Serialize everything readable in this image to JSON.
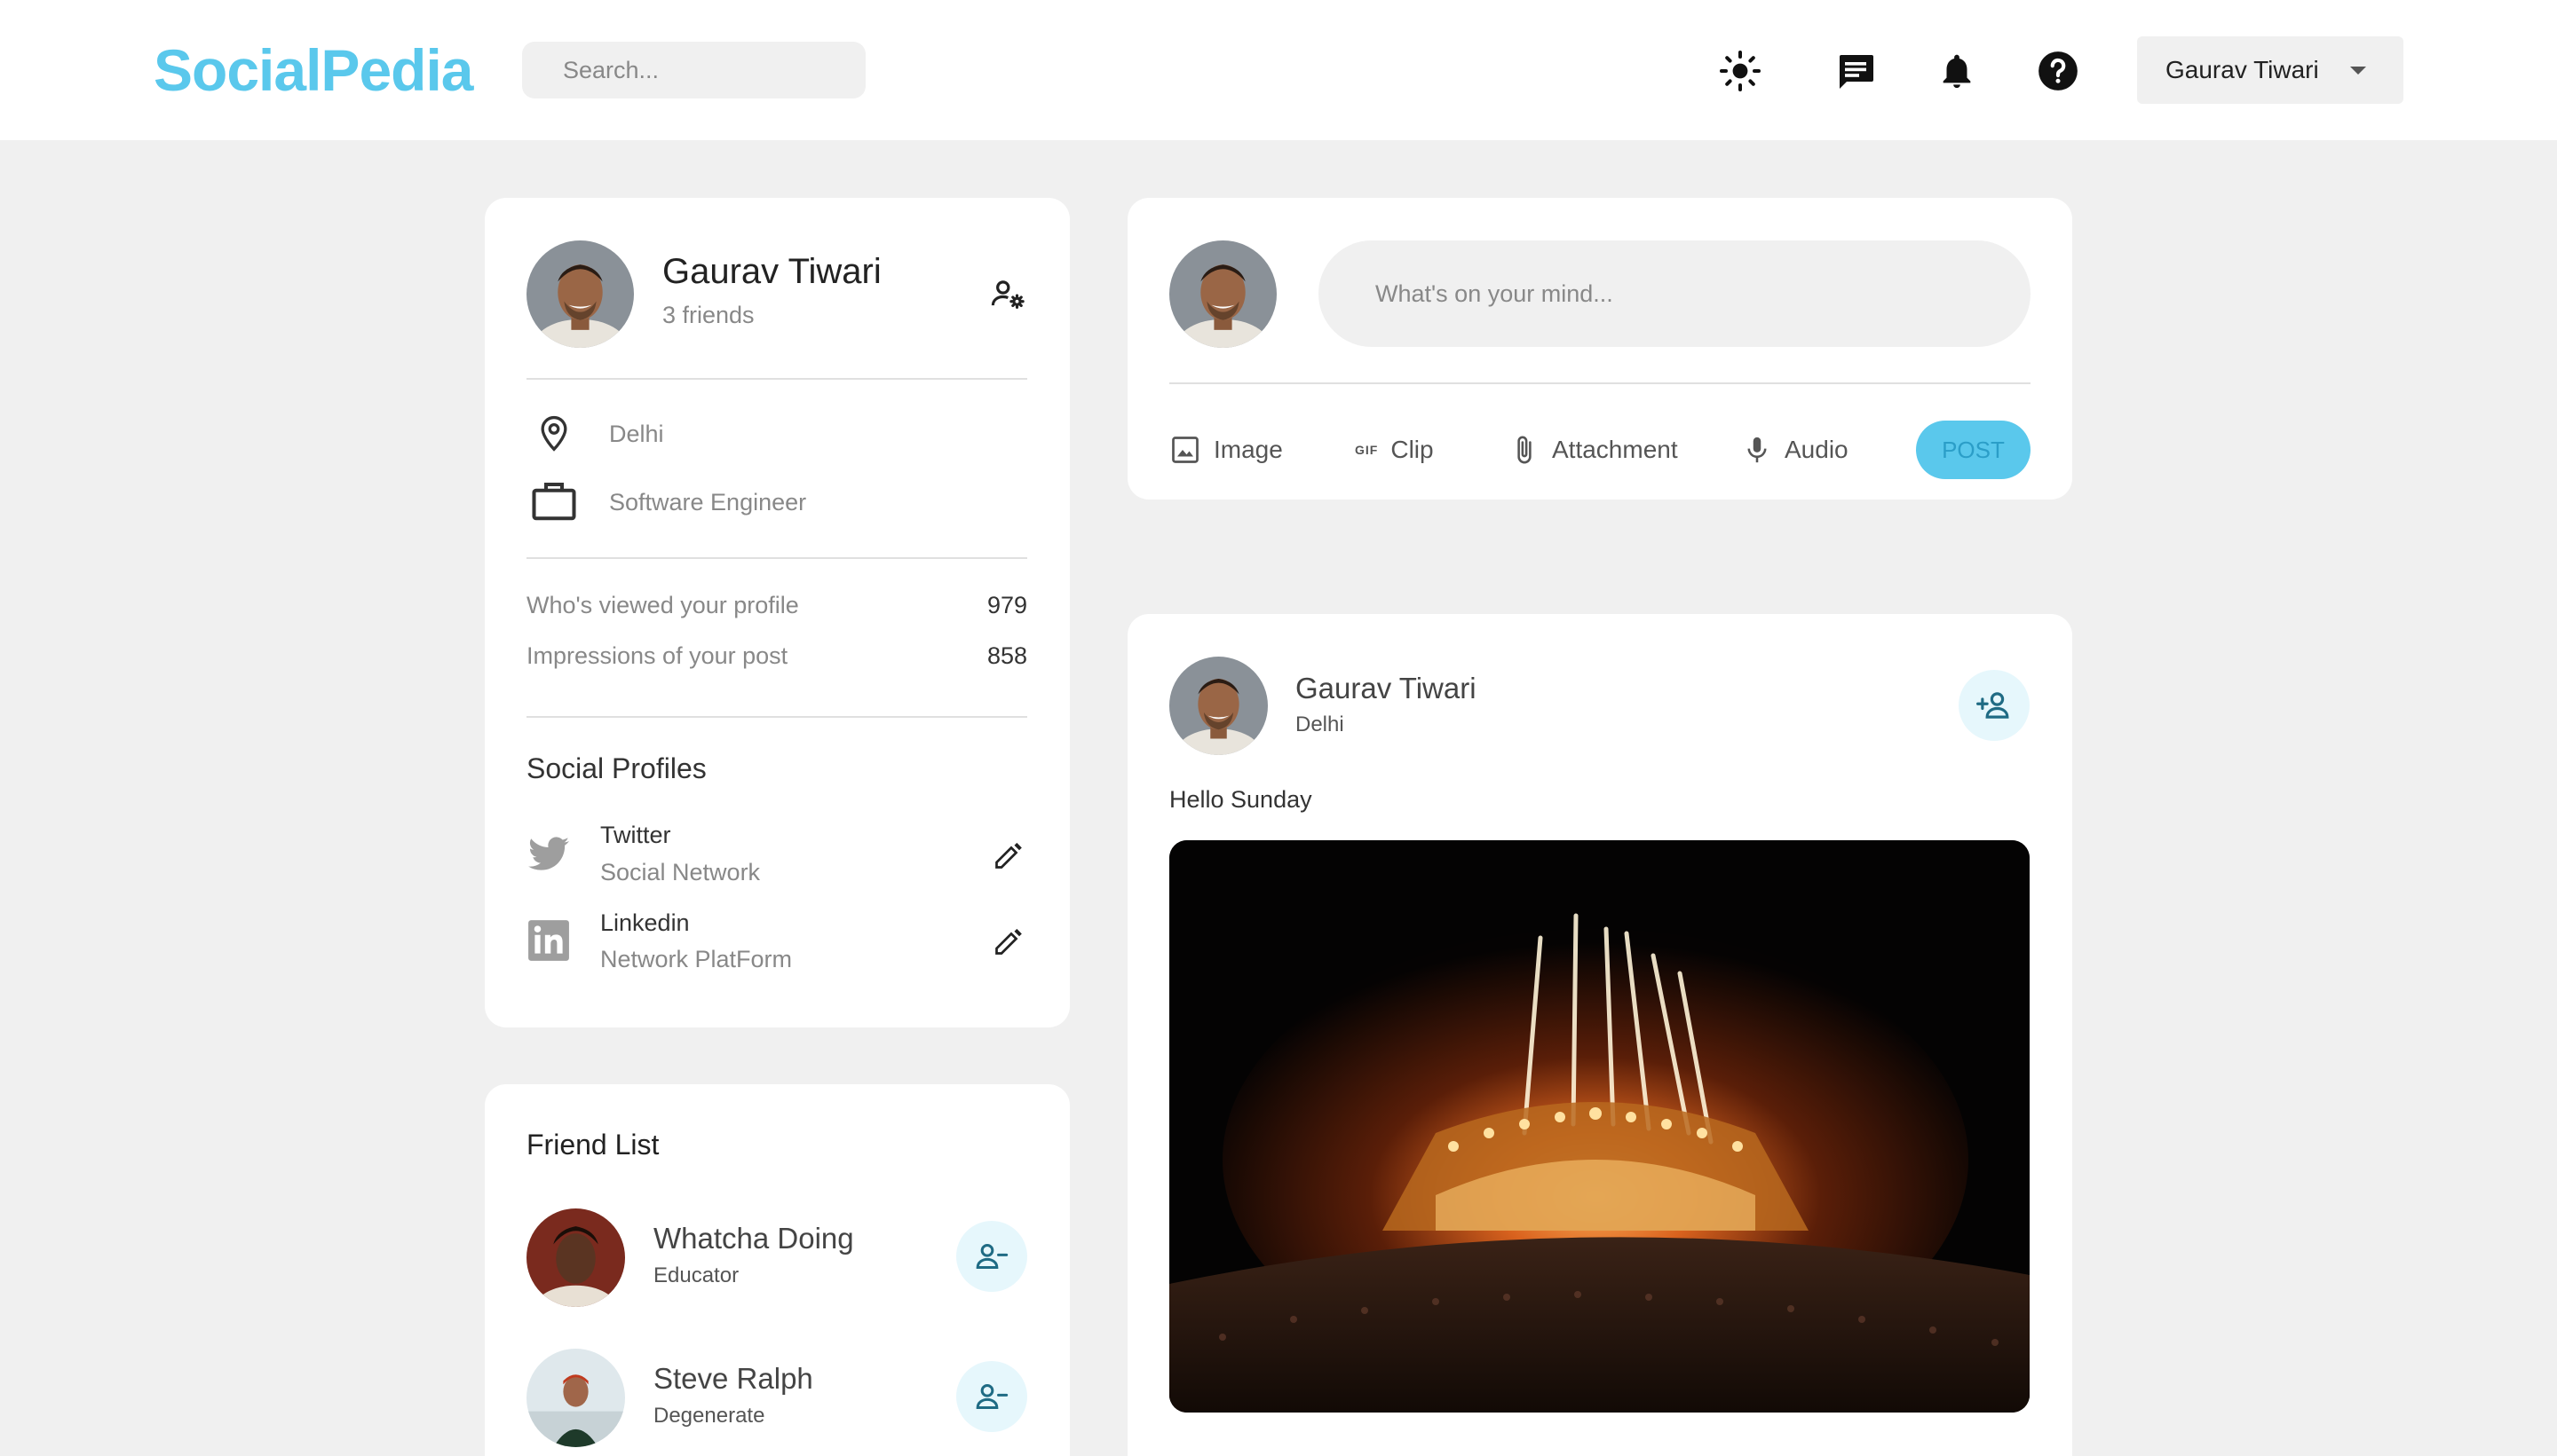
{
  "navbar": {
    "logo": "SocialPedia",
    "search_placeholder": "Search...",
    "user_name": "Gaurav Tiwari",
    "icons": [
      "light-mode-icon",
      "message-icon",
      "notification-icon",
      "help-icon"
    ]
  },
  "profile": {
    "name": "Gaurav Tiwari",
    "friends": "3 friends",
    "location": "Delhi",
    "occupation": "Software Engineer",
    "stats": [
      {
        "label": "Who's viewed your profile",
        "value": "979"
      },
      {
        "label": "Impressions of your post",
        "value": "858"
      }
    ],
    "social_title": "Social Profiles",
    "social": [
      {
        "name": "Twitter",
        "desc": "Social Network"
      },
      {
        "name": "Linkedin",
        "desc": "Network PlatForm"
      }
    ]
  },
  "composer": {
    "placeholder": "What's on your mind...",
    "actions": [
      "Image",
      "Clip",
      "Attachment",
      "Audio"
    ],
    "post_label": "POST"
  },
  "post": {
    "author": "Gaurav Tiwari",
    "location": "Delhi",
    "text": "Hello Sunday"
  },
  "friends": {
    "title": "Friend List",
    "items": [
      {
        "name": "Whatcha Doing",
        "role": "Educator"
      },
      {
        "name": "Steve Ralph",
        "role": "Degenerate"
      }
    ]
  },
  "colors": {
    "brand": "#5ac8ec",
    "background": "#f0f0f0",
    "card": "#ffffff",
    "icon_bubble": "#e6f7fc"
  }
}
